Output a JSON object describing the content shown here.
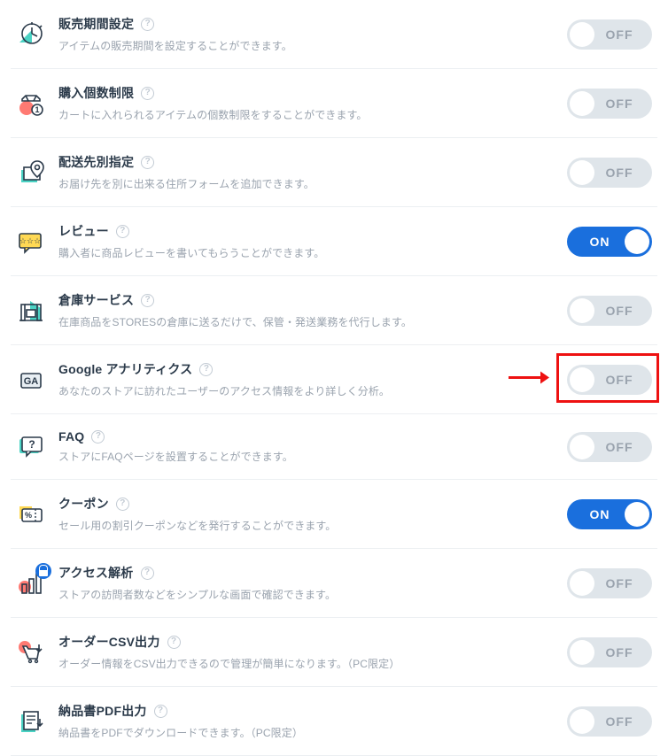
{
  "toggle_on_label": "ON",
  "toggle_off_label": "OFF",
  "settings": [
    {
      "id": "sales-period",
      "title": "販売期間設定",
      "desc": "アイテムの販売期間を設定することができます。",
      "state": "off",
      "highlight": false,
      "locked": false
    },
    {
      "id": "purchase-limit",
      "title": "購入個数制限",
      "desc": "カートに入れられるアイテムの個数制限をすることができます。",
      "state": "off",
      "highlight": false,
      "locked": false
    },
    {
      "id": "shipping-address",
      "title": "配送先別指定",
      "desc": "お届け先を別に出来る住所フォームを追加できます。",
      "state": "off",
      "highlight": false,
      "locked": false
    },
    {
      "id": "review",
      "title": "レビュー",
      "desc": "購入者に商品レビューを書いてもらうことができます。",
      "state": "on",
      "highlight": false,
      "locked": false
    },
    {
      "id": "warehouse",
      "title": "倉庫サービス",
      "desc": "在庫商品をSTORESの倉庫に送るだけで、保管・発送業務を代行します。",
      "state": "off",
      "highlight": false,
      "locked": false
    },
    {
      "id": "google-analytics",
      "title": "Google アナリティクス",
      "desc": "あなたのストアに訪れたユーザーのアクセス情報をより詳しく分析。",
      "state": "off",
      "highlight": true,
      "locked": false
    },
    {
      "id": "faq",
      "title": "FAQ",
      "desc": "ストアにFAQページを設置することができます。",
      "state": "off",
      "highlight": false,
      "locked": false
    },
    {
      "id": "coupon",
      "title": "クーポン",
      "desc": "セール用の割引クーポンなどを発行することができます。",
      "state": "on",
      "highlight": false,
      "locked": false
    },
    {
      "id": "access-analysis",
      "title": "アクセス解析",
      "desc": "ストアの訪問者数などをシンプルな画面で確認できます。",
      "state": "off",
      "highlight": false,
      "locked": true
    },
    {
      "id": "order-csv",
      "title": "オーダーCSV出力",
      "desc": "オーダー情報をCSV出力できるので管理が簡単になります。（PC限定）",
      "state": "off",
      "highlight": false,
      "locked": false
    },
    {
      "id": "invoice-pdf",
      "title": "納品書PDF出力",
      "desc": "納品書をPDFでダウンロードできます。（PC限定）",
      "state": "off",
      "highlight": false,
      "locked": false
    }
  ],
  "colors": {
    "accent": "#1a6fdd",
    "teal": "#4bd3c4",
    "yellow": "#ffd954",
    "red": "#ff7a73",
    "highlight": "#e11"
  }
}
